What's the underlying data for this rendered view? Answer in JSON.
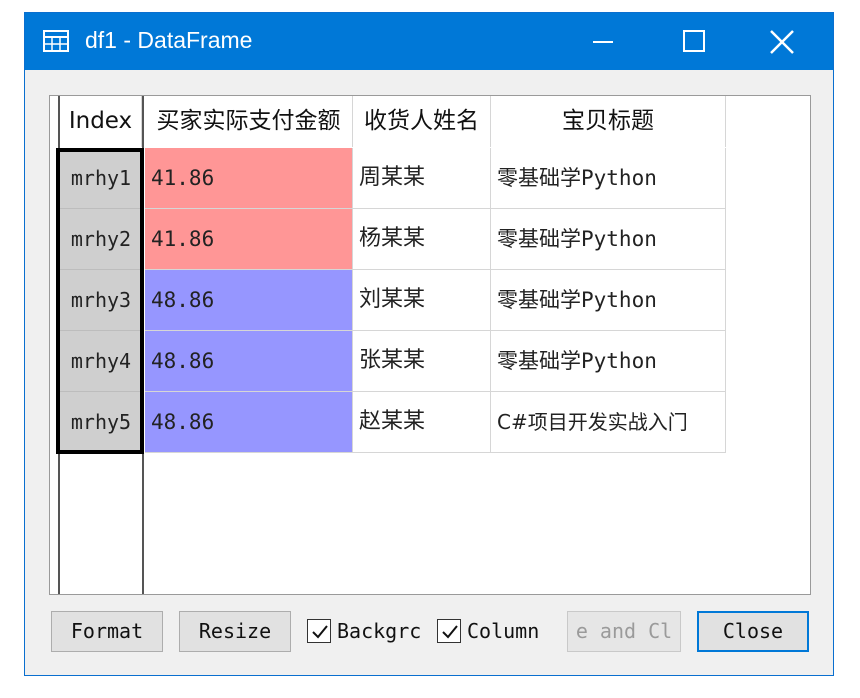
{
  "window": {
    "title": "df1 - DataFrame",
    "accent_color": "#0078d7",
    "icons": {
      "app": "table-icon",
      "minimize": "minimize-icon",
      "maximize": "maximize-icon",
      "close": "close-icon"
    }
  },
  "table": {
    "index_header": "Index",
    "columns": [
      "买家实际支付金额",
      "收货人姓名",
      "宝贝标题"
    ],
    "rows": [
      {
        "index": "mrhy1",
        "amount": "41.86",
        "name": "周某某",
        "title": "零基础学Python",
        "amount_color": "#ff9696"
      },
      {
        "index": "mrhy2",
        "amount": "41.86",
        "name": "杨某某",
        "title": "零基础学Python",
        "amount_color": "#ff9696"
      },
      {
        "index": "mrhy3",
        "amount": "48.86",
        "name": "刘某某",
        "title": "零基础学Python",
        "amount_color": "#9696ff"
      },
      {
        "index": "mrhy4",
        "amount": "48.86",
        "name": "张某某",
        "title": "零基础学Python",
        "amount_color": "#9696ff"
      },
      {
        "index": "mrhy5",
        "amount": "48.86",
        "name": "赵某某",
        "title": "C#项目开发实战入门",
        "amount_color": "#9696ff"
      }
    ]
  },
  "footer": {
    "format_label": "Format",
    "resize_label": "Resize",
    "background_label": "Backgrc",
    "background_checked": true,
    "column_label": "Column",
    "column_checked": true,
    "disabled_label": "e and Cl",
    "close_label": "Close"
  }
}
